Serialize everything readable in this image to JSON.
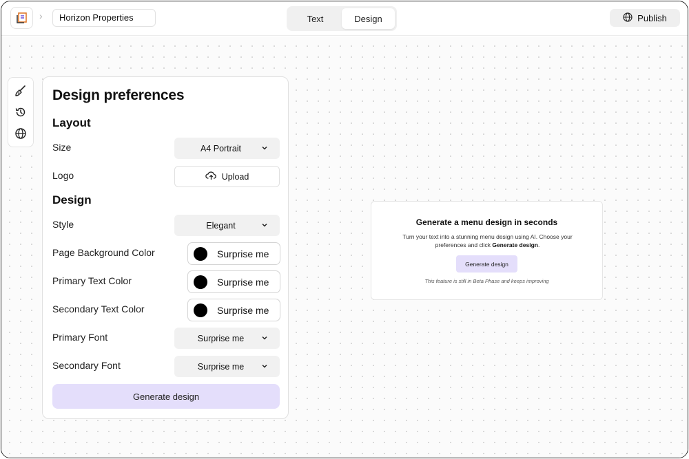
{
  "header": {
    "logo_icon": "document-logo-icon",
    "breadcrumb_icon": "chevron-right-icon",
    "project_name": "Horizon Properties",
    "modes": [
      {
        "label": "Text",
        "active": false
      },
      {
        "label": "Design",
        "active": true
      }
    ],
    "publish_label": "Publish",
    "publish_icon": "globe-icon"
  },
  "toolstrip": {
    "tools": [
      "brush-icon",
      "history-icon",
      "globe-icon"
    ]
  },
  "panel": {
    "title": "Design preferences",
    "layout_section": "Layout",
    "size_label": "Size",
    "size_value": "A4 Portrait",
    "logo_label": "Logo",
    "upload_label": "Upload",
    "design_section": "Design",
    "style_label": "Style",
    "style_value": "Elegant",
    "page_bg_label": "Page Background Color",
    "page_bg_value": "Surprise me",
    "primary_text_label": "Primary Text Color",
    "primary_text_value": "Surprise me",
    "secondary_text_label": "Secondary Text Color",
    "secondary_text_value": "Surprise me",
    "primary_font_label": "Primary Font",
    "primary_font_value": "Surprise me",
    "secondary_font_label": "Secondary Font",
    "secondary_font_value": "Surprise me",
    "generate_label": "Generate design"
  },
  "card": {
    "title": "Generate a menu design in seconds",
    "body_prefix": "Turn your text into a stunning menu design using AI. Choose your preferences and click ",
    "body_emphasis": "Generate design",
    "body_suffix": ".",
    "button_label": "Generate design",
    "note": "This feature is still in Beta Phase and keeps improving"
  },
  "colors": {
    "accent": "#e4defb",
    "swatch": "#000000"
  }
}
